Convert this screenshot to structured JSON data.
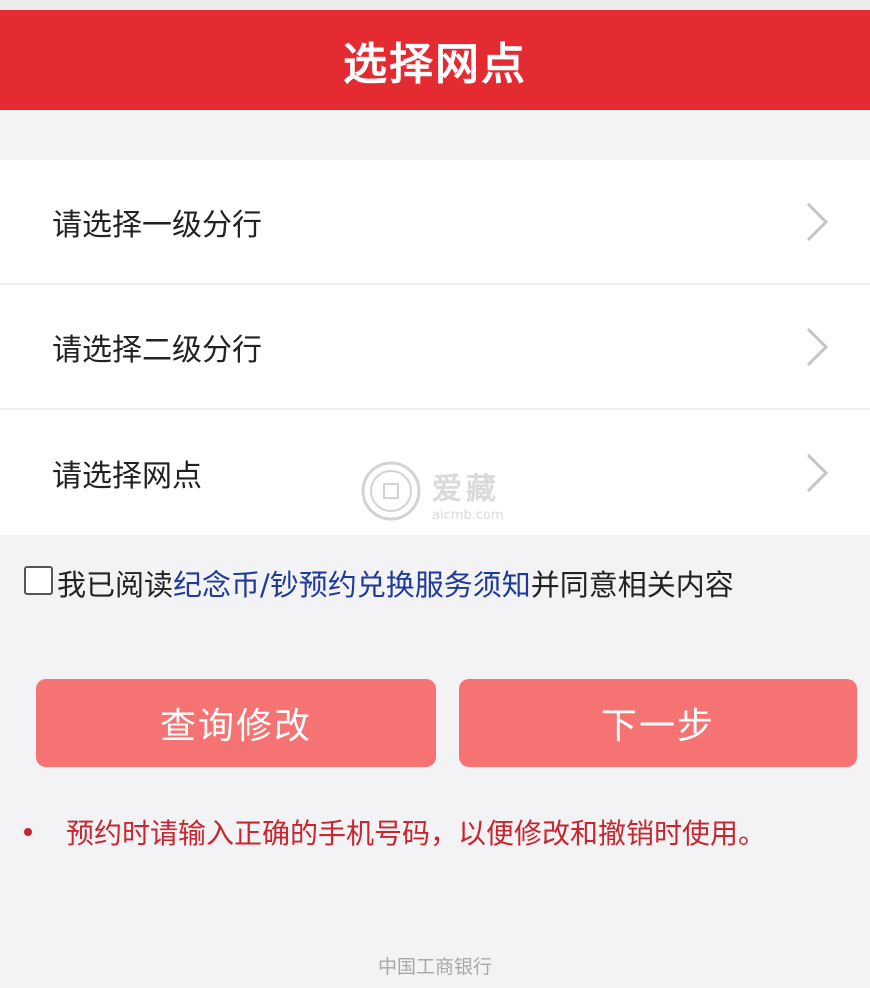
{
  "header": {
    "title": "选择网点"
  },
  "select_rows": [
    {
      "label": "请选择一级分行"
    },
    {
      "label": "请选择二级分行"
    },
    {
      "label": "请选择网点"
    }
  ],
  "watermark": {
    "title": "爱藏",
    "url": "aicmb.com"
  },
  "agreement": {
    "checked": false,
    "prefix": "我已阅读",
    "link_text": "纪念币/钞预约兑换服务须知",
    "suffix": "并同意相关内容"
  },
  "buttons": {
    "query_label": "查询修改",
    "next_label": "下一步"
  },
  "notice": {
    "text": "预约时请输入正确的手机号码，以便修改和撤销时使用。"
  },
  "footer": {
    "text": "中国工商银行"
  },
  "colors": {
    "header_bg": "#e52b32",
    "button_bg": "#f57373",
    "link": "#1e3a9a",
    "notice": "#c8262f"
  },
  "icons": {
    "row_chevron": "chevron-right-icon"
  }
}
